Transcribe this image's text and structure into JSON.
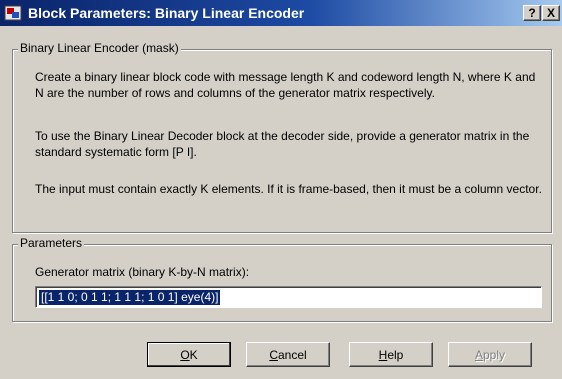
{
  "window": {
    "title": "Block Parameters: Binary Linear Encoder",
    "help_glyph": "?",
    "close_glyph": "X"
  },
  "description_group": {
    "legend": "Binary Linear Encoder (mask)",
    "paragraphs": [
      "Create a binary linear block code with message length K and codeword length N, where K and N are the number of rows and columns of the generator matrix respectively.",
      "To use the Binary Linear Decoder block at the decoder side, provide a generator matrix in the standard systematic form [P I].",
      "The input must contain exactly K elements.  If it is frame-based, then it must be a column vector."
    ]
  },
  "parameters_group": {
    "legend": "Parameters",
    "generator_matrix": {
      "label": "Generator matrix (binary K-by-N matrix):",
      "value": "[[1 1 0; 0 1 1; 1 1 1; 1 0 1] eye(4)]"
    }
  },
  "buttons": {
    "ok": {
      "accel": "O",
      "rest": "K"
    },
    "cancel": {
      "accel": "C",
      "rest": "ancel"
    },
    "help": {
      "accel": "H",
      "rest": "elp"
    },
    "apply": {
      "accel": "A",
      "rest": "pply"
    }
  },
  "colors": {
    "title_bar_start": "#0a246a",
    "title_bar_end": "#a6caf0",
    "dialog_background": "#d4d0c8",
    "selection": "#0a246a"
  },
  "icons": {
    "app": "simulink-block-icon",
    "help": "question-mark-icon",
    "close": "close-icon"
  }
}
